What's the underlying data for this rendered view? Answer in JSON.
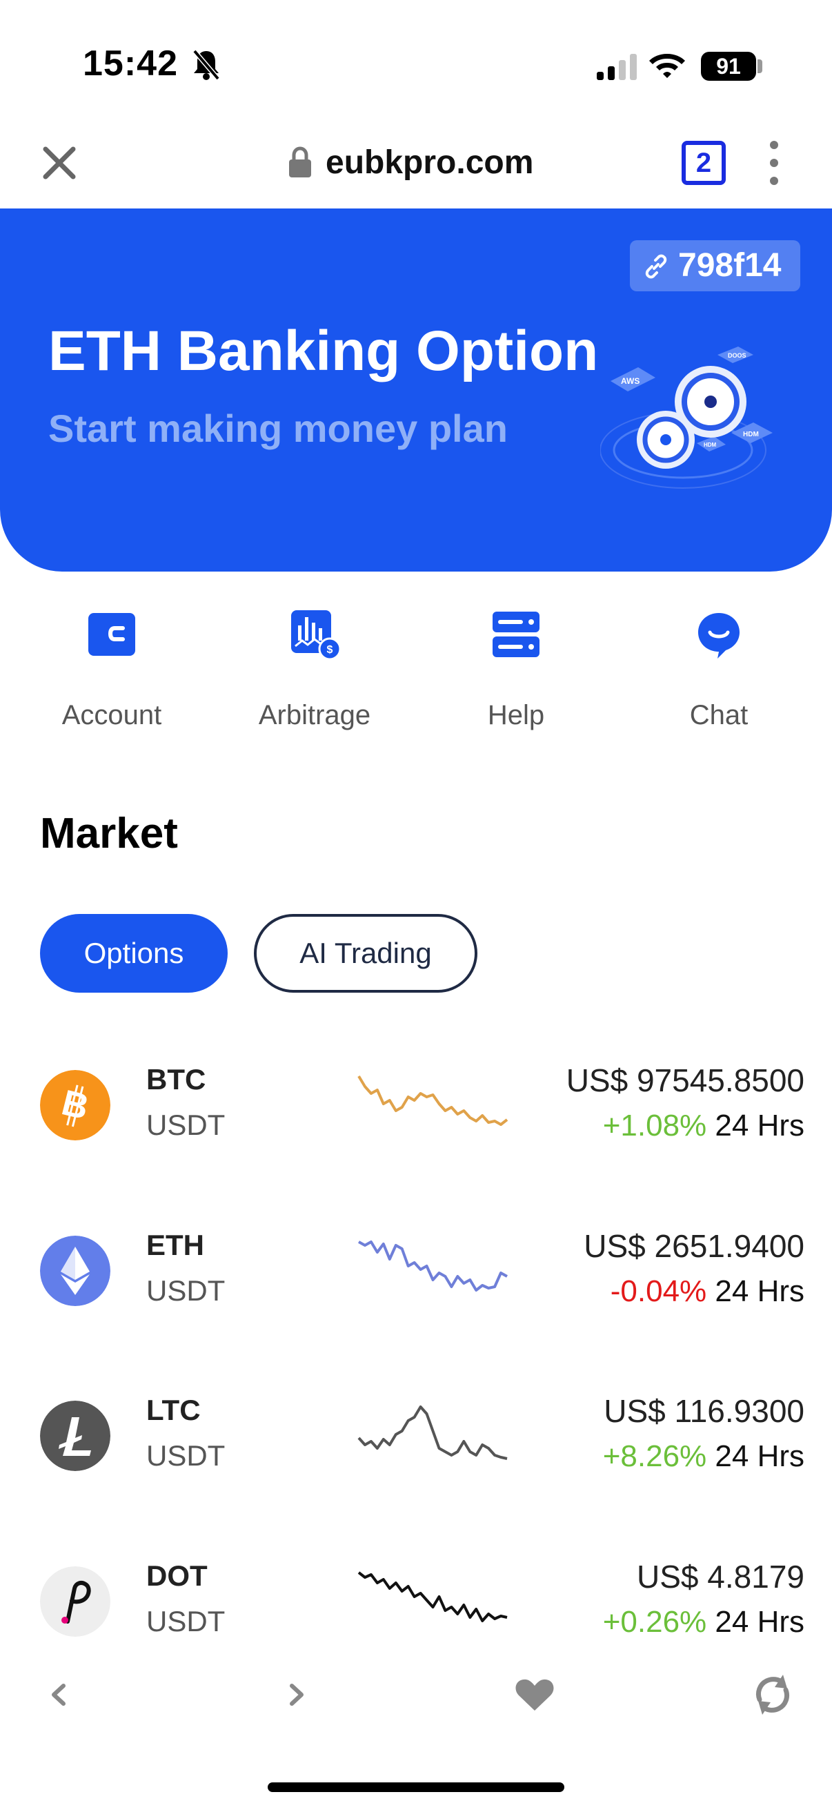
{
  "status_bar": {
    "time": "15:42",
    "battery": "91"
  },
  "browser": {
    "url": "eubkpro.com",
    "tab_count": "2"
  },
  "hero": {
    "ref_code": "798f14",
    "title": "ETH Banking Option",
    "subtitle": "Start making money plan",
    "art_tags": [
      "AWS",
      "DOOS",
      "HDM",
      "HDM"
    ]
  },
  "quick_nav": [
    {
      "label": "Account",
      "icon": "wallet-icon"
    },
    {
      "label": "Arbitrage",
      "icon": "chart-dollar-icon"
    },
    {
      "label": "Help",
      "icon": "server-icon"
    },
    {
      "label": "Chat",
      "icon": "chat-bubble-icon"
    }
  ],
  "market": {
    "title": "Market",
    "tabs": [
      {
        "label": "Options",
        "active": true
      },
      {
        "label": "AI Trading",
        "active": false
      }
    ],
    "coins": [
      {
        "symbol": "BTC",
        "quote": "USDT",
        "price": "US$ 97545.8500",
        "change": "+1.08%",
        "period": "24 Hrs",
        "direction": "up",
        "logo_color": "#f7931a",
        "spark_color": "#e0a24a",
        "spark": [
          0.85,
          0.7,
          0.6,
          0.65,
          0.45,
          0.5,
          0.35,
          0.4,
          0.55,
          0.5,
          0.6,
          0.55,
          0.58,
          0.45,
          0.35,
          0.4,
          0.3,
          0.35,
          0.25,
          0.2,
          0.28,
          0.18,
          0.2,
          0.15,
          0.22
        ]
      },
      {
        "symbol": "ETH",
        "quote": "USDT",
        "price": "US$ 2651.9400",
        "change": "-0.04%",
        "period": "24 Hrs",
        "direction": "down",
        "logo_color": "#627eea",
        "spark_color": "#6f7fd8",
        "spark": [
          0.85,
          0.8,
          0.85,
          0.7,
          0.82,
          0.6,
          0.8,
          0.75,
          0.5,
          0.55,
          0.45,
          0.5,
          0.3,
          0.4,
          0.35,
          0.2,
          0.35,
          0.25,
          0.3,
          0.15,
          0.22,
          0.18,
          0.2,
          0.4,
          0.35
        ]
      },
      {
        "symbol": "LTC",
        "quote": "USDT",
        "price": "US$ 116.9300",
        "change": "+8.26%",
        "period": "24 Hrs",
        "direction": "up",
        "logo_color": "#555555",
        "spark_color": "#555555",
        "spark": [
          0.4,
          0.3,
          0.35,
          0.25,
          0.38,
          0.3,
          0.45,
          0.5,
          0.65,
          0.7,
          0.85,
          0.75,
          0.5,
          0.25,
          0.2,
          0.15,
          0.2,
          0.35,
          0.2,
          0.15,
          0.3,
          0.25,
          0.15,
          0.12,
          0.1
        ]
      },
      {
        "symbol": "DOT",
        "quote": "USDT",
        "price": "US$ 4.8179",
        "change": "+0.26%",
        "period": "24 Hrs",
        "direction": "up",
        "logo_color": "#eeeeee",
        "spark_color": "#111111",
        "spark": [
          0.85,
          0.78,
          0.82,
          0.7,
          0.75,
          0.62,
          0.7,
          0.58,
          0.65,
          0.5,
          0.55,
          0.45,
          0.35,
          0.5,
          0.3,
          0.35,
          0.25,
          0.38,
          0.2,
          0.32,
          0.15,
          0.25,
          0.18,
          0.22,
          0.2
        ]
      }
    ]
  }
}
